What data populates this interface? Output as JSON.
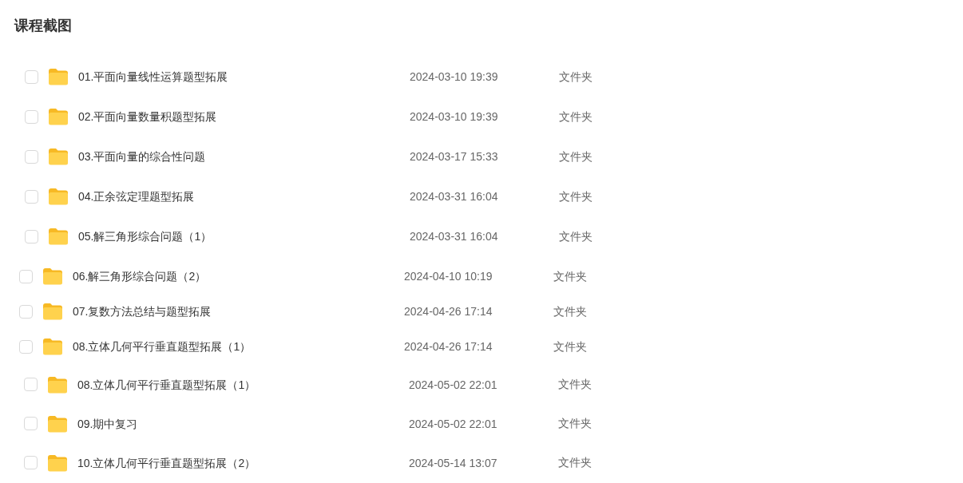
{
  "title": "课程截图",
  "captures": [
    {
      "rows": [
        {
          "name": "01.平面向量线性运算题型拓展",
          "modified": "2024-03-10 19:39",
          "type": "文件夹",
          "checked": false
        },
        {
          "name": "02.平面向量数量积题型拓展",
          "modified": "2024-03-10 19:39",
          "type": "文件夹",
          "checked": false
        },
        {
          "name": "03.平面向量的综合性问题",
          "modified": "2024-03-17 15:33",
          "type": "文件夹",
          "checked": false
        },
        {
          "name": "04.正余弦定理题型拓展",
          "modified": "2024-03-31 16:04",
          "type": "文件夹",
          "checked": false
        },
        {
          "name": "05.解三角形综合问题（1）",
          "modified": "2024-03-31 16:04",
          "type": "文件夹",
          "checked": false
        }
      ]
    },
    {
      "rows": [
        {
          "name": "06.解三角形综合问题（2）",
          "modified": "2024-04-10 10:19",
          "type": "文件夹",
          "checked": false
        },
        {
          "name": "07.复数方法总结与题型拓展",
          "modified": "2024-04-26 17:14",
          "type": "文件夹",
          "checked": false
        },
        {
          "name": "08.立体几何平行垂直题型拓展（1）",
          "modified": "2024-04-26 17:14",
          "type": "文件夹",
          "checked": false
        }
      ]
    },
    {
      "rows": [
        {
          "name": "08.立体几何平行垂直题型拓展（1）",
          "modified": "2024-05-02 22:01",
          "type": "文件夹",
          "checked": false
        },
        {
          "name": "09.期中复习",
          "modified": "2024-05-02 22:01",
          "type": "文件夹",
          "checked": false
        },
        {
          "name": "10.立体几何平行垂直题型拓展（2）",
          "modified": "2024-05-14 13:07",
          "type": "文件夹",
          "checked": false
        }
      ]
    }
  ]
}
